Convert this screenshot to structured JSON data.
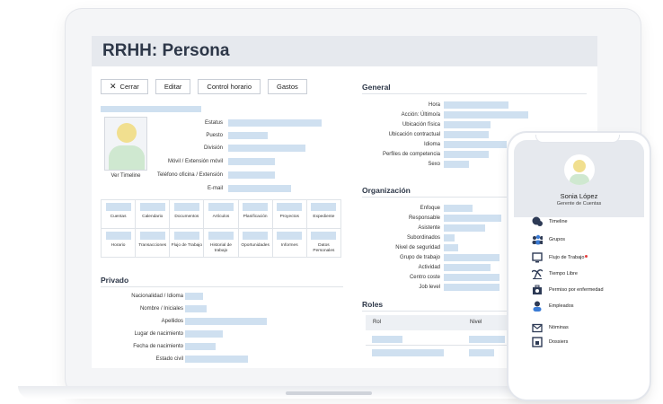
{
  "page": {
    "title": "RRHH: Persona"
  },
  "toolbar": {
    "close": "Cerrar",
    "edit": "Editar",
    "time_control": "Control horario",
    "expenses": "Gastos"
  },
  "profile": {
    "timeline_link": "Ver Timeline",
    "fields": [
      "Estatus",
      "Puesto",
      "División",
      "Móvil / Extensión móvil",
      "Teléfono oficina / Extensión",
      "E-mail"
    ]
  },
  "tiles": {
    "row1": [
      "Cuentas",
      "Calendario",
      "Documentos",
      "Artículos",
      "Planificación",
      "Proyectos",
      "Expediente"
    ],
    "row2": [
      "Horario",
      "Transacciones",
      "Flujo de Trabajo",
      "Historial de trabajo",
      "Oportunidades",
      "Informes",
      "Datos Personales"
    ]
  },
  "private": {
    "heading": "Privado",
    "fields": [
      "Nacionalidad / Idioma",
      "Nombre / Iniciales",
      "Apellidos",
      "Lugar de nacimiento",
      "Fecha de nacimiento",
      "Estado civil"
    ]
  },
  "general": {
    "heading": "General",
    "fields": [
      "Hora",
      "Acción: Último/a",
      "Ubicación física",
      "Ubicación contractual",
      "Idioma",
      "Perfiles de competencia",
      "Sexo"
    ]
  },
  "organization": {
    "heading": "Organización",
    "fields": [
      "Enfoque",
      "Responsable",
      "Asistente",
      "Subordinados",
      "Nivel de seguridad",
      "Grupo de trabajo",
      "Actividad",
      "Centro coste",
      "Job level"
    ]
  },
  "roles": {
    "heading": "Roles",
    "col_role": "Rol",
    "col_level": "Nivel"
  },
  "phone": {
    "name": "Sonia López",
    "role": "Gerente de Cuentas",
    "menu": [
      "Timeline",
      "Grupos",
      "Flujo de Trabajo",
      "Tiempo Libre",
      "Permiso por enfermedad",
      "Empleados",
      "Nóminas",
      "Dossiers"
    ]
  },
  "colors": {
    "placeholder": "#cfe0f0",
    "header": "#e6e9ee",
    "icon": "#2d3a55"
  }
}
